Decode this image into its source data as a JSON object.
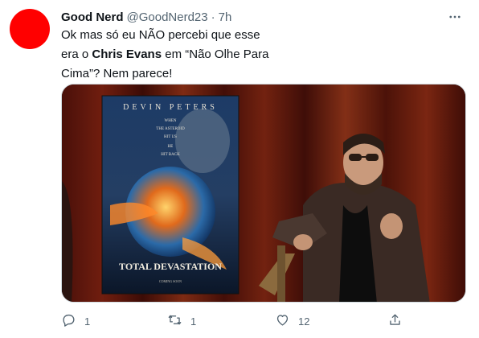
{
  "tweet": {
    "avatar_color": "#ff0000",
    "display_name": "Good Nerd",
    "handle": "@GoodNerd23",
    "separator": "·",
    "time": "7h",
    "more_icon": "ellipsis-icon",
    "text": {
      "part1": "Ok mas só eu NÃO percebi que esse era o ",
      "bold": "Chris Evans",
      "part2": " em “Não Olhe Para Cima”? Nem parece!"
    },
    "media": {
      "poster_top": "DEVIN PETERS",
      "poster_lines": [
        "WHEN",
        "THE ASTEROID",
        "HIT US",
        "HE",
        "HIT BACK"
      ],
      "poster_title": "TOTAL DEVASTATION",
      "poster_footer": "COMING SOON"
    },
    "actions": {
      "reply": {
        "icon": "reply-icon",
        "count": "1"
      },
      "retweet": {
        "icon": "retweet-icon",
        "count": "1"
      },
      "like": {
        "icon": "heart-icon",
        "count": "12"
      },
      "share": {
        "icon": "share-icon"
      }
    }
  }
}
